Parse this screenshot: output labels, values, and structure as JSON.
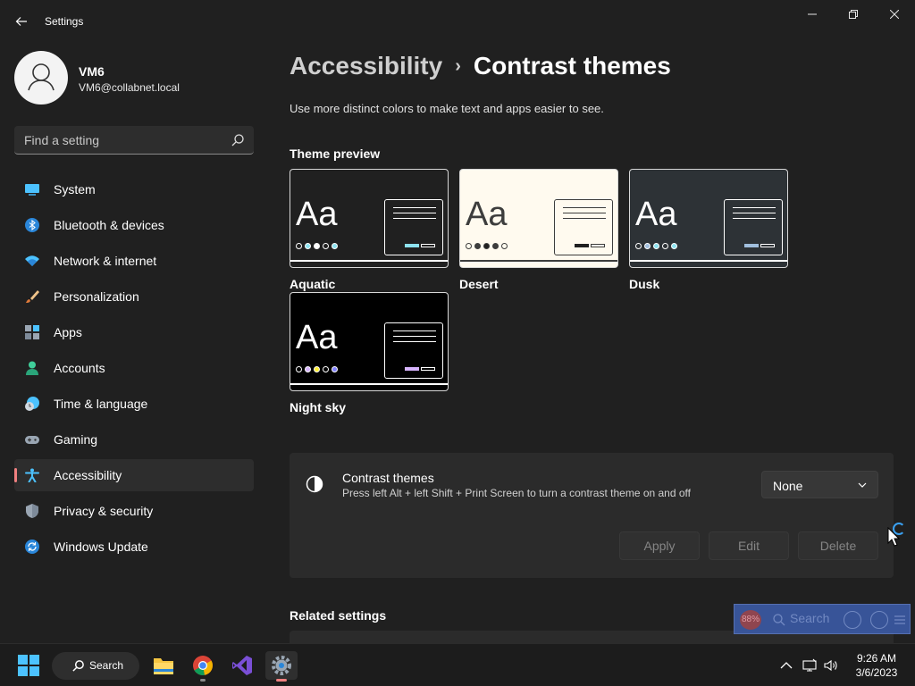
{
  "window": {
    "title": "Settings"
  },
  "user": {
    "name": "VM6",
    "email": "VM6@collabnet.local"
  },
  "search": {
    "placeholder": "Find a setting"
  },
  "sidebar": {
    "items": [
      {
        "label": "System",
        "icon": "monitor-icon"
      },
      {
        "label": "Bluetooth & devices",
        "icon": "bluetooth-icon"
      },
      {
        "label": "Network & internet",
        "icon": "wifi-icon"
      },
      {
        "label": "Personalization",
        "icon": "brush-icon"
      },
      {
        "label": "Apps",
        "icon": "apps-icon"
      },
      {
        "label": "Accounts",
        "icon": "person-icon"
      },
      {
        "label": "Time & language",
        "icon": "clock-globe-icon"
      },
      {
        "label": "Gaming",
        "icon": "gamepad-icon"
      },
      {
        "label": "Accessibility",
        "icon": "accessibility-icon",
        "active": true
      },
      {
        "label": "Privacy & security",
        "icon": "shield-icon"
      },
      {
        "label": "Windows Update",
        "icon": "update-icon"
      }
    ]
  },
  "main": {
    "breadcrumb_parent": "Accessibility",
    "breadcrumb_separator": "›",
    "title": "Contrast themes",
    "subtitle": "Use more distinct colors to make text and apps easier to see.",
    "preview_heading": "Theme preview",
    "sample_text": "Aa",
    "themes": [
      {
        "name": "Aquatic",
        "bg": "#202020",
        "fg": "#ffffff",
        "accent": "#8ee3f0",
        "dots": [
          "#202020",
          "#8ee3f0",
          "#ffffff",
          "#202020",
          "#8ee3f0"
        ]
      },
      {
        "name": "Desert",
        "bg": "#fffaef",
        "fg": "#3d3d3d",
        "accent": "#202020",
        "dots": [
          "#fffaef",
          "#3d3d3d",
          "#202020",
          "#3d3d3d",
          "#fffaef"
        ]
      },
      {
        "name": "Dusk",
        "bg": "#2d3236",
        "fg": "#ffffff",
        "accent": "#a1bfde",
        "dots": [
          "#2d3236",
          "#a1bfde",
          "#8ee3f0",
          "#2d3236",
          "#8ee3f0"
        ]
      },
      {
        "name": "Night sky",
        "bg": "#000000",
        "fg": "#ffffff",
        "accent": "#d6b4fd",
        "dots": [
          "#000000",
          "#d6b4fd",
          "#ffee32",
          "#000000",
          "#8080ff"
        ]
      }
    ],
    "contrast_panel": {
      "title": "Contrast themes",
      "description": "Press left Alt + left Shift + Print Screen to turn a contrast theme on and off",
      "dropdown_value": "None",
      "apply_label": "Apply",
      "edit_label": "Edit",
      "delete_label": "Delete"
    },
    "related_heading": "Related settings"
  },
  "overlay": {
    "badge": "88%",
    "search_label": "Search"
  },
  "taskbar": {
    "search_label": "Search",
    "time": "9:26 AM",
    "date": "3/6/2023"
  },
  "colors": {
    "accent": "#4cc2ff",
    "active_indicator": "#f08080",
    "background": "#202020"
  }
}
